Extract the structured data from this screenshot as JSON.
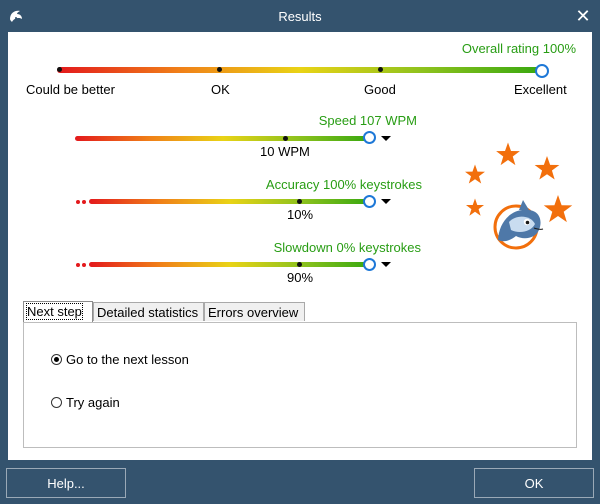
{
  "window": {
    "title": "Results",
    "close_glyph": "✕"
  },
  "overall": {
    "label": "Overall rating 100%",
    "ticks": [
      "Could be better",
      "OK",
      "Good",
      "Excellent"
    ],
    "value_percent": 100
  },
  "metrics": [
    {
      "label": "Speed 107 WPM",
      "sublabel": "10 WPM"
    },
    {
      "label": "Accuracy 100% keystrokes",
      "sublabel": "10%"
    },
    {
      "label": "Slowdown 0% keystrokes",
      "sublabel": "90%"
    }
  ],
  "tabs": [
    {
      "label": "Next step",
      "active": true
    },
    {
      "label": "Detailed statistics",
      "active": false
    },
    {
      "label": "Errors overview",
      "active": false
    }
  ],
  "next_step": {
    "options": [
      {
        "label": "Go to the next lesson",
        "checked": true
      },
      {
        "label": "Try again",
        "checked": false
      }
    ]
  },
  "buttons": {
    "help": "Help...",
    "ok": "OK"
  },
  "colors": {
    "titlebar": "#34536e",
    "accent_green": "#289d14",
    "marker_blue": "#1e78d7",
    "star_orange": "#f26f0c"
  },
  "icons": {
    "app": "dolphin-icon",
    "mascot": "dolphin-mascot-icon",
    "stars": "star-icon"
  }
}
